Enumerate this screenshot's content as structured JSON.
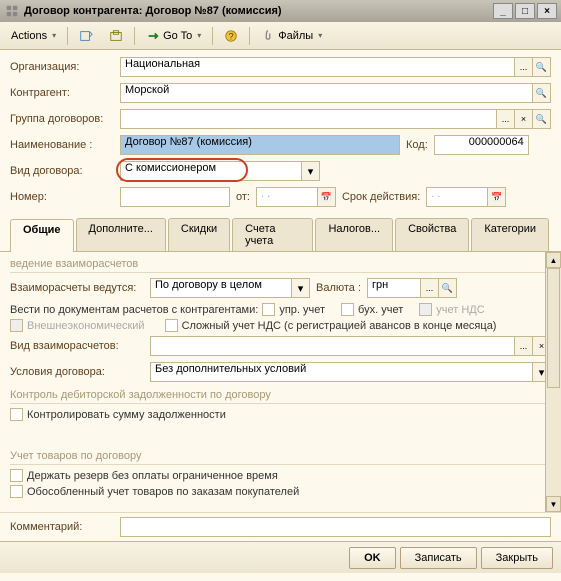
{
  "window": {
    "title": "Договор контрагента: Договор №87 (комиссия)"
  },
  "toolbar": {
    "actions": "Actions",
    "goto": "Go To",
    "files": "Файлы"
  },
  "form": {
    "org_label": "Организация:",
    "org_value": "Национальная",
    "contragent_label": "Контрагент:",
    "contragent_value": "Морской",
    "group_label": "Группа договоров:",
    "group_value": "",
    "name_label": "Наименование :",
    "name_value": "Договор №87 (комиссия)",
    "code_label": "Код:",
    "code_value": "000000064",
    "type_label": "Вид договора:",
    "type_value": "С комиссионером",
    "number_label": "Номер:",
    "number_value": "",
    "number_from": "от:",
    "date_ph": ".  .",
    "validity_label": "Срок действия:"
  },
  "tabs": {
    "tab0": "Общие",
    "tab1": "Дополните...",
    "tab2": "Скидки",
    "tab3": "Счета учета",
    "tab4": "Налогов...",
    "tab5": "Свойства",
    "tab6": "Категории"
  },
  "content": {
    "sec0": "ведение взаиморасчетов",
    "mutual_label": "Взаиморасчеты ведутся:",
    "mutual_value": "По договору в целом",
    "currency_label": "Валюта :",
    "currency_value": "грн",
    "docs_label": "Вести по документам расчетов с контрагентами:",
    "cb_upr": "упр. учет",
    "cb_bukh": "бух. учет",
    "cb_nds": "учет НДС",
    "cb_foreign": "Внешнеэкономический",
    "cb_complex": "Сложный  учет НДС (с регистрацией авансов в конце месяца)",
    "mutual_type_label": "Вид взаиморасчетов:",
    "mutual_type_value": "",
    "conditions_label": "Условия договора:",
    "conditions_value": "Без дополнительных условий",
    "sec1": "Контроль дебиторской задолженности по договору",
    "cb_control": "Контролировать сумму задолженности",
    "sec2": "Учет товаров по договору",
    "cb_reserve": "Держать резерв без оплаты ограниченное время",
    "cb_separate": "Обособленный учет товаров по заказам покупателей"
  },
  "comment_label": "Комментарий:",
  "comment_value": "",
  "footer": {
    "ok": "OK",
    "write": "Записать",
    "close": "Закрыть"
  }
}
